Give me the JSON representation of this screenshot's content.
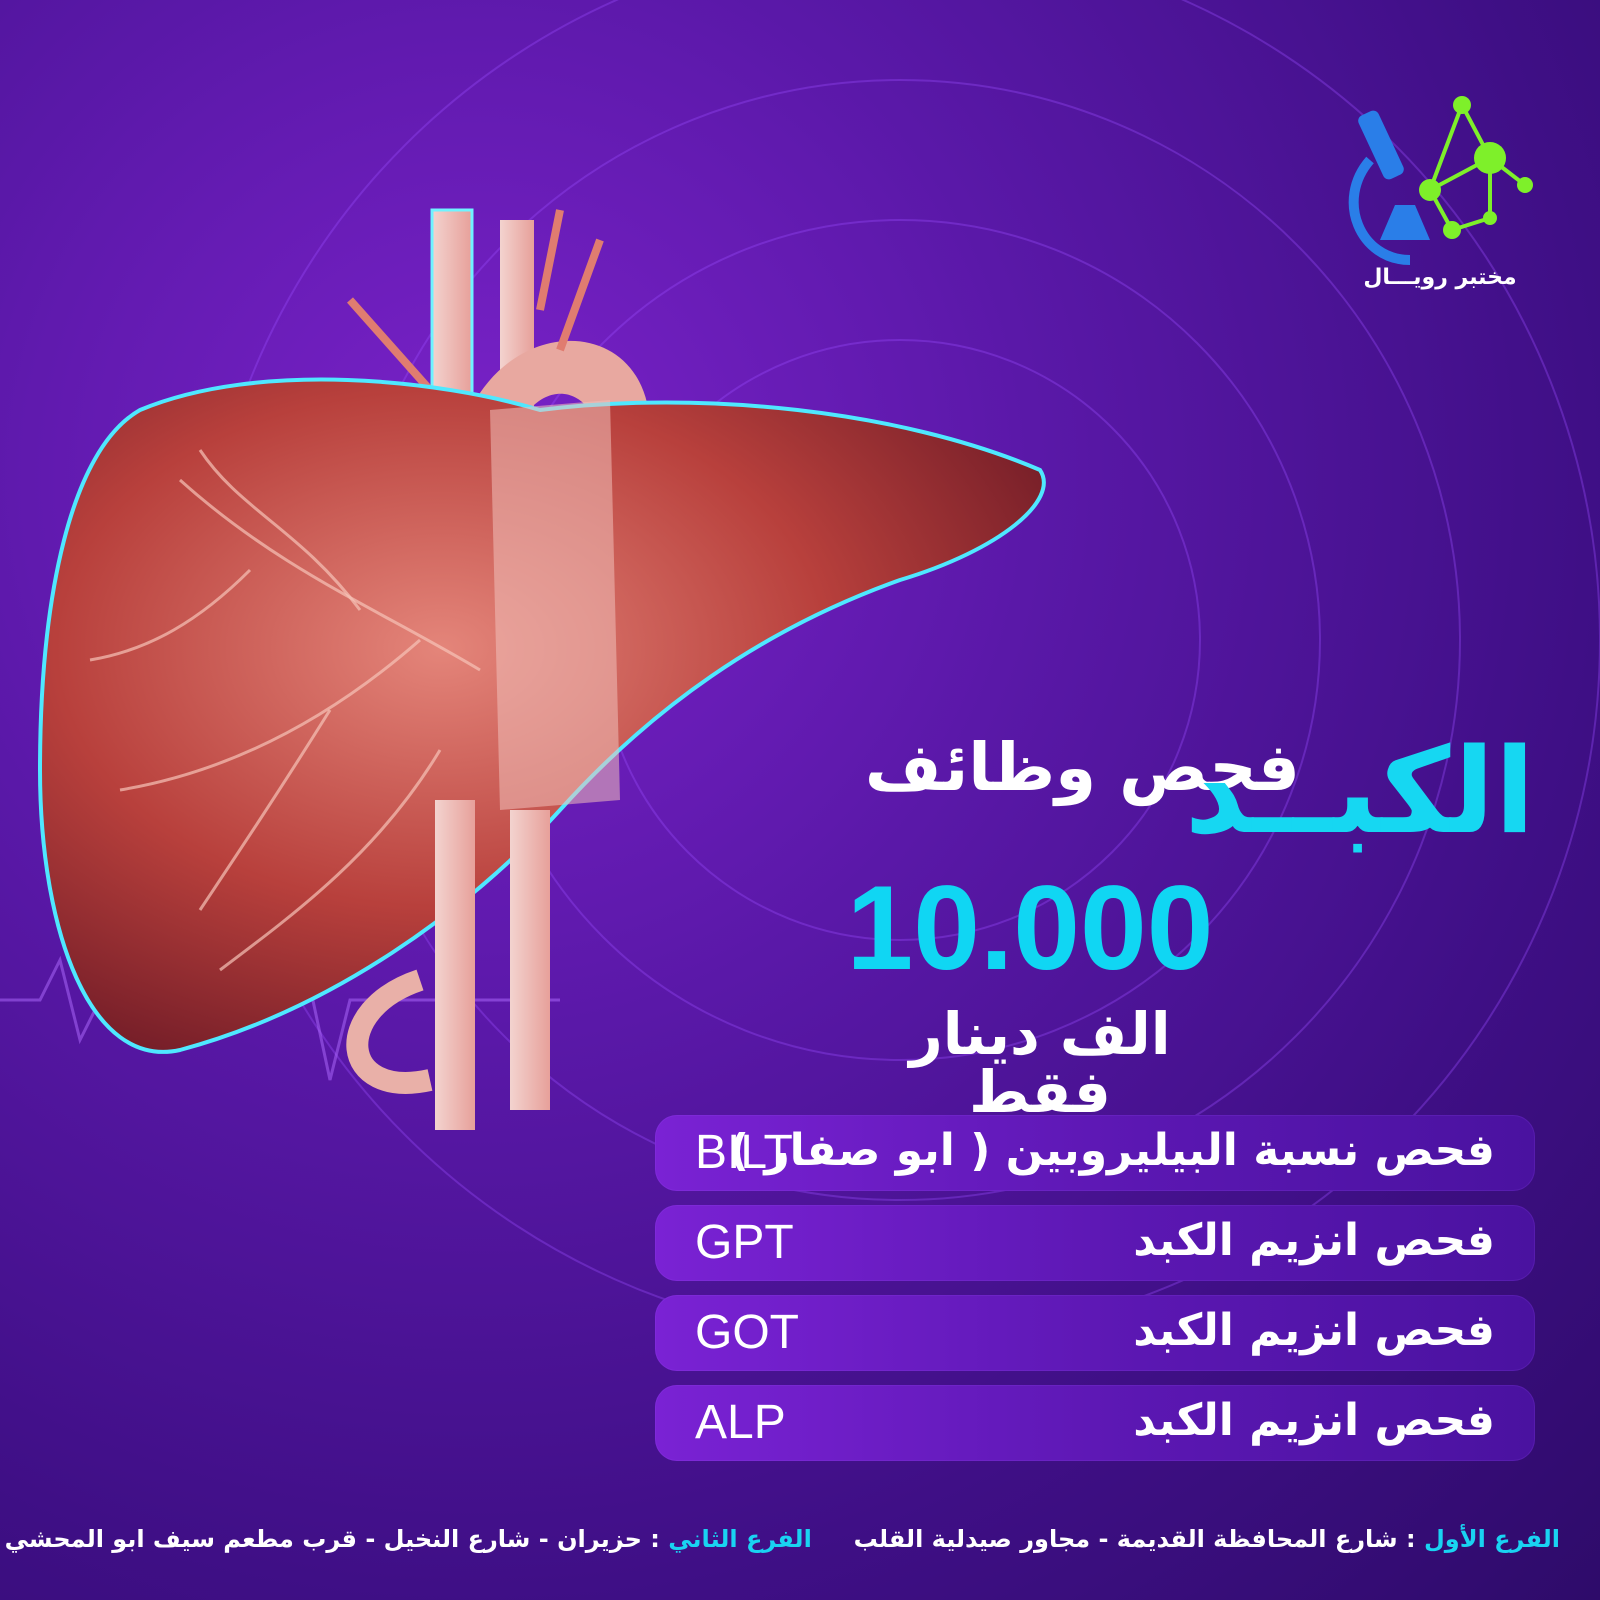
{
  "logo": {
    "name": "مختبر رويـــال",
    "icon": "microscope-molecule-logo"
  },
  "headline": {
    "small": "فحص وظائف",
    "big": "الكبــد"
  },
  "price": {
    "value": "10.000",
    "note": "الف دينار فقط"
  },
  "tests": [
    {
      "name": "فحص نسبة البيليروبين ( ابو صفار )",
      "code": "BILT"
    },
    {
      "name": "فحص انزيم الكبد",
      "code": "GPT"
    },
    {
      "name": "فحص انزيم الكبد",
      "code": "GOT"
    },
    {
      "name": "فحص انزيم الكبد",
      "code": "ALP"
    }
  ],
  "footer": {
    "branch1_label": "الفرع الأول",
    "branch1_sep": " : ",
    "branch1_text": "شارع المحافظة القديمة - مجاور صيدلية القلب",
    "branch2_label": "الفرع الثاني",
    "branch2_sep": " : ",
    "branch2_text": "حزيران - شارع النخيل - قرب مطعم سيف ابو المحشي"
  },
  "colors": {
    "accent": "#16d7f2",
    "background": "#4a12a0",
    "row": "#6a1cc4",
    "logo_green": "#7ef02a",
    "logo_blue": "#2a7ee8"
  }
}
